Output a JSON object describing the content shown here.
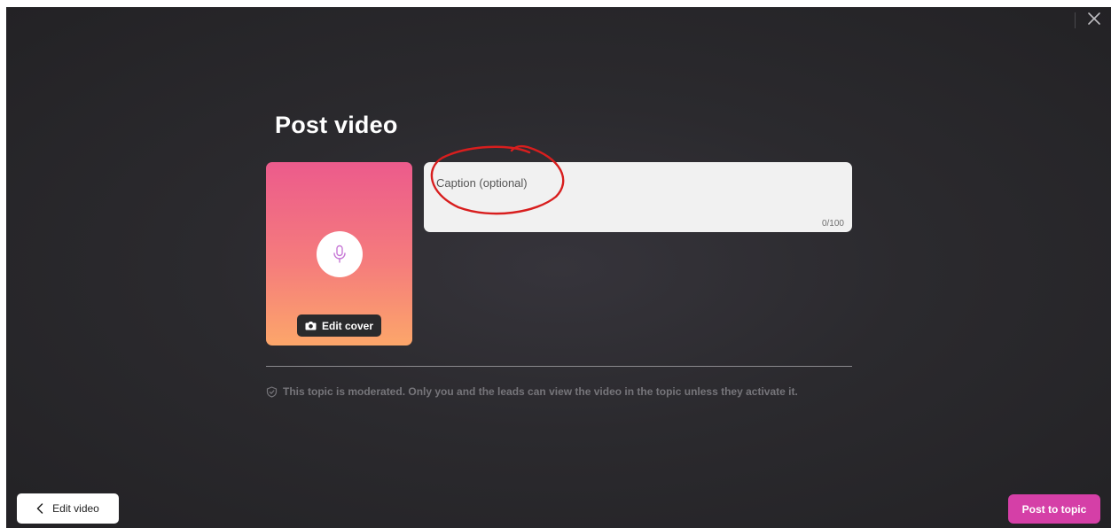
{
  "header": {
    "title": "Post video"
  },
  "cover": {
    "edit_cover_label": "Edit cover",
    "icon": "microphone-icon"
  },
  "caption": {
    "placeholder": "Caption (optional)",
    "value": "",
    "char_count": "0/100"
  },
  "notice": {
    "text": "This topic is moderated. Only you and the leads can view the video in the topic unless they activate it.",
    "icon": "shield-check-icon"
  },
  "footer": {
    "back_label": "Edit video",
    "post_label": "Post to topic"
  },
  "colors": {
    "background": "#2b2a2e",
    "accent": "#d53fa7",
    "cover_gradient_top": "#ec5b8c",
    "cover_gradient_bottom": "#fca66a",
    "annotation": "#d81e1e"
  }
}
